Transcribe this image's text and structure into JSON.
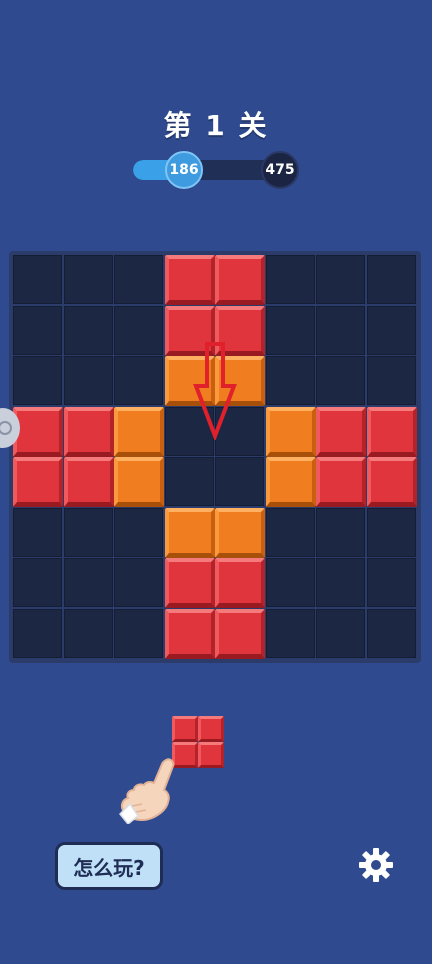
{
  "level": {
    "title": "第 1 关"
  },
  "progress": {
    "current": "186",
    "target": "475",
    "fraction": 0.39
  },
  "board": {
    "size": 8,
    "blocks": [
      {
        "row": 0,
        "col": 3,
        "color": "red"
      },
      {
        "row": 0,
        "col": 4,
        "color": "red"
      },
      {
        "row": 1,
        "col": 3,
        "color": "red"
      },
      {
        "row": 1,
        "col": 4,
        "color": "red"
      },
      {
        "row": 2,
        "col": 3,
        "color": "orange"
      },
      {
        "row": 2,
        "col": 4,
        "color": "orange"
      },
      {
        "row": 3,
        "col": 0,
        "color": "red"
      },
      {
        "row": 3,
        "col": 1,
        "color": "red"
      },
      {
        "row": 3,
        "col": 2,
        "color": "orange"
      },
      {
        "row": 3,
        "col": 5,
        "color": "orange"
      },
      {
        "row": 3,
        "col": 6,
        "color": "red"
      },
      {
        "row": 3,
        "col": 7,
        "color": "red"
      },
      {
        "row": 4,
        "col": 0,
        "color": "red"
      },
      {
        "row": 4,
        "col": 1,
        "color": "red"
      },
      {
        "row": 4,
        "col": 2,
        "color": "orange"
      },
      {
        "row": 4,
        "col": 5,
        "color": "orange"
      },
      {
        "row": 4,
        "col": 6,
        "color": "red"
      },
      {
        "row": 4,
        "col": 7,
        "color": "red"
      },
      {
        "row": 5,
        "col": 3,
        "color": "orange"
      },
      {
        "row": 5,
        "col": 4,
        "color": "orange"
      },
      {
        "row": 6,
        "col": 3,
        "color": "red"
      },
      {
        "row": 6,
        "col": 4,
        "color": "red"
      },
      {
        "row": 7,
        "col": 3,
        "color": "red"
      },
      {
        "row": 7,
        "col": 4,
        "color": "red"
      }
    ]
  },
  "hint": {
    "icon": "down-arrow-icon"
  },
  "piece": {
    "shape": "2x2",
    "color": "red"
  },
  "buttons": {
    "how_to_play": "怎么玩?",
    "settings_icon": "gear-icon"
  },
  "colors": {
    "background": "#2f4a8f",
    "red": "#e0353c",
    "orange": "#f07d1f",
    "progress": "#3aa0e8"
  }
}
